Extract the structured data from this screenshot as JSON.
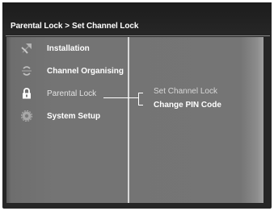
{
  "header": {
    "breadcrumb_root": "Parental Lock",
    "breadcrumb_separator": ">",
    "breadcrumb_current": "Set Channel Lock"
  },
  "menu": {
    "items": [
      {
        "label": "Installation",
        "icon": "satellite-dish-icon"
      },
      {
        "label": "Channel Organising",
        "icon": "channel-organise-icon"
      },
      {
        "label": "Parental Lock",
        "icon": "padlock-icon",
        "active": true
      },
      {
        "label": "System Setup",
        "icon": "gear-icon"
      }
    ]
  },
  "submenu": {
    "items": [
      {
        "label": "Set Channel Lock",
        "selected": true
      },
      {
        "label": "Change PIN Code"
      }
    ]
  },
  "colors": {
    "screen_bg": "#262626",
    "panel_bg": "#757575",
    "text": "#ffffff"
  }
}
